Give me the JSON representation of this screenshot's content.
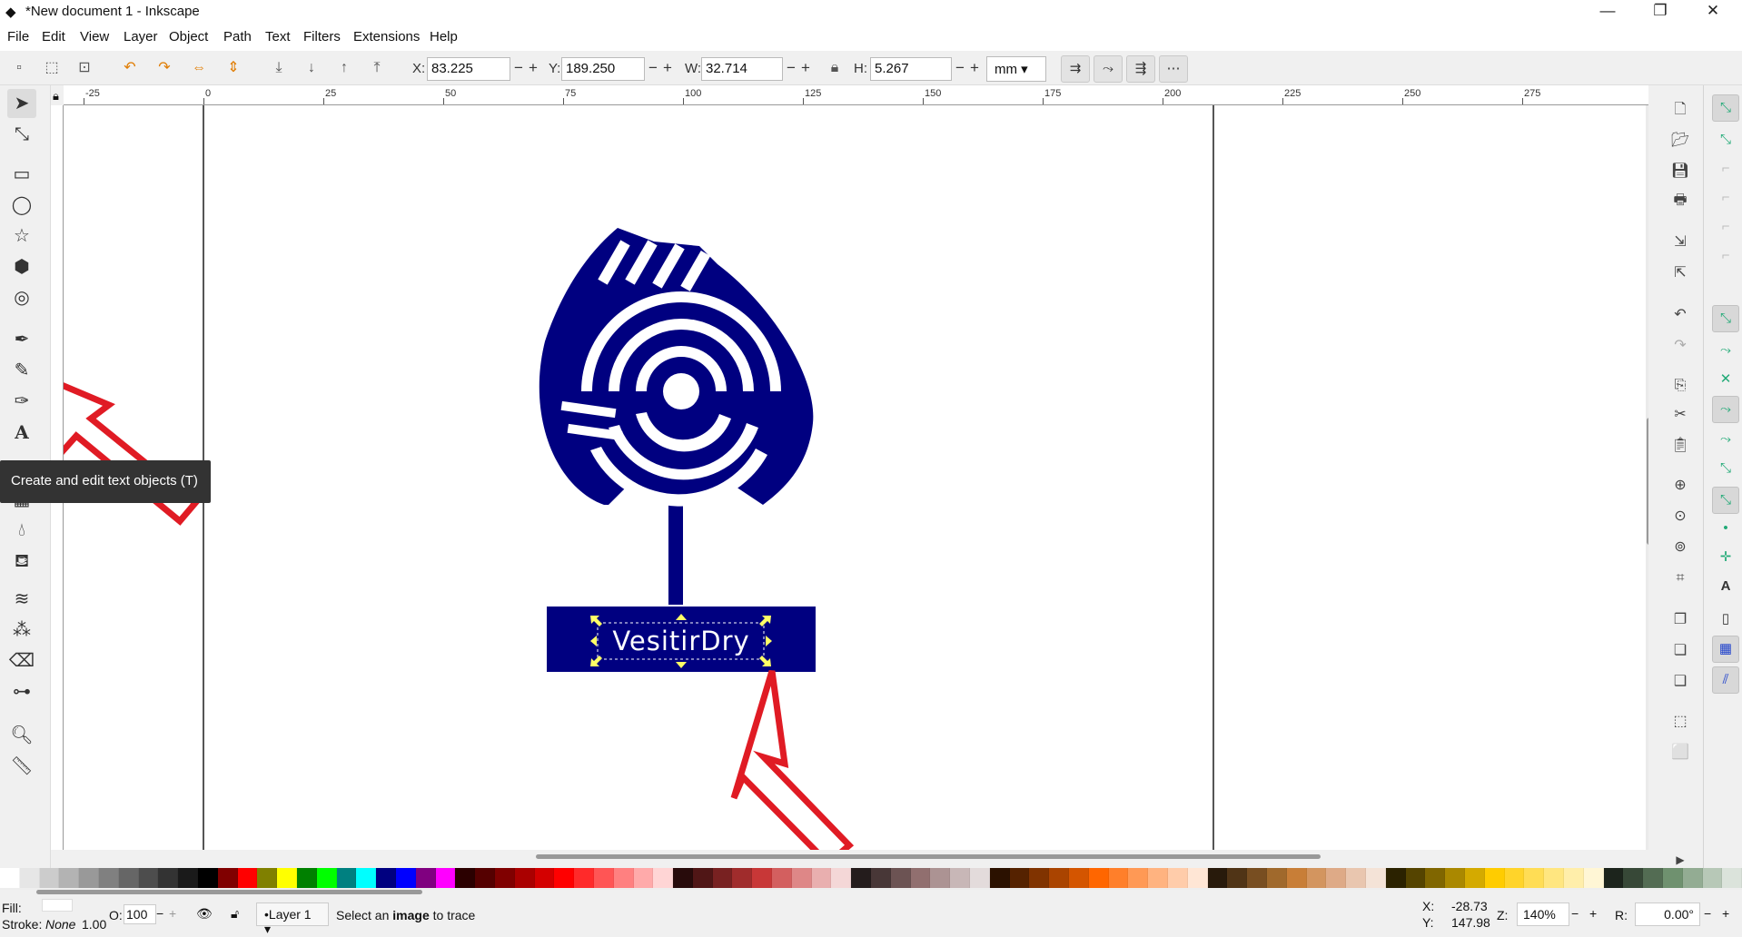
{
  "window": {
    "title": "*New document 1 - Inkscape",
    "minimize": "—",
    "restore": "❐",
    "close": "✕"
  },
  "menu": [
    "File",
    "Edit",
    "View",
    "Layer",
    "Object",
    "Path",
    "Text",
    "Filters",
    "Extensions",
    "Help"
  ],
  "toolbar": {
    "x_label": "X:",
    "x_value": "83.225",
    "y_label": "Y:",
    "y_value": "189.250",
    "w_label": "W:",
    "w_value": "32.714",
    "h_label": "H:",
    "h_value": "5.267",
    "unit": "mm",
    "minus": "−",
    "plus": "+"
  },
  "ruler": {
    "top_labels": [
      "-25",
      "0",
      "25",
      "50",
      "75",
      "100",
      "125",
      "150",
      "175",
      "200",
      "225",
      "250",
      "275"
    ]
  },
  "canvas": {
    "logo_text": "VesitirDry",
    "logo_color": "#000080"
  },
  "tooltip": {
    "text": "Create and edit text objects (T)"
  },
  "statusbar": {
    "fill_label": "Fill:",
    "stroke_label": "Stroke:",
    "stroke_value": "None",
    "stroke_width": "1.00",
    "opacity_label": "O:",
    "opacity_value": "100",
    "layer": "•Layer 1",
    "message_prefix": "Select an ",
    "message_bold": "image",
    "message_suffix": " to trace",
    "x_label": "X:",
    "x_value": "-28.73",
    "y_label": "Y:",
    "y_value": "147.98",
    "zoom_label": "Z:",
    "zoom_value": "140%",
    "rotate_label": "R:",
    "rotate_value": "0.00°"
  },
  "palette_colors": [
    "#ffffff",
    "#e6e6e6",
    "#cccccc",
    "#b3b3b3",
    "#999999",
    "#808080",
    "#666666",
    "#4d4d4d",
    "#333333",
    "#1a1a1a",
    "#000000",
    "#800000",
    "#ff0000",
    "#808000",
    "#ffff00",
    "#008000",
    "#00ff00",
    "#008080",
    "#00ffff",
    "#000080",
    "#0000ff",
    "#800080",
    "#ff00ff",
    "#2b0000",
    "#550000",
    "#800000",
    "#aa0000",
    "#d40000",
    "#ff0000",
    "#ff2a2a",
    "#ff5555",
    "#ff8080",
    "#ffaaaa",
    "#ffd5d5",
    "#280b0b",
    "#501616",
    "#782121",
    "#a02c2c",
    "#c83737",
    "#d35f5f",
    "#de8787",
    "#e9afaf",
    "#f4d7d7",
    "#241c1c",
    "#483737",
    "#6c5353",
    "#916f6f",
    "#ac9393",
    "#c8b7b7",
    "#e3dbdb",
    "#2b1100",
    "#552200",
    "#803300",
    "#aa4400",
    "#d45500",
    "#ff6600",
    "#ff7f2a",
    "#ff9955",
    "#ffb380",
    "#ffccaa",
    "#ffe6d5",
    "#281a0b",
    "#503416",
    "#784e21",
    "#a0692c",
    "#c87e37",
    "#d3955f",
    "#deaa87",
    "#e9c6af",
    "#f4e3d7",
    "#2b2200",
    "#554400",
    "#806600",
    "#aa8800",
    "#d4aa00",
    "#ffcc00",
    "#ffd42a",
    "#ffdd55",
    "#ffe680",
    "#ffeeaa",
    "#fff6d5",
    "#1c241c",
    "#374837",
    "#536c53",
    "#6f916f",
    "#93ac93",
    "#b7c8b7",
    "#dbe3db"
  ]
}
